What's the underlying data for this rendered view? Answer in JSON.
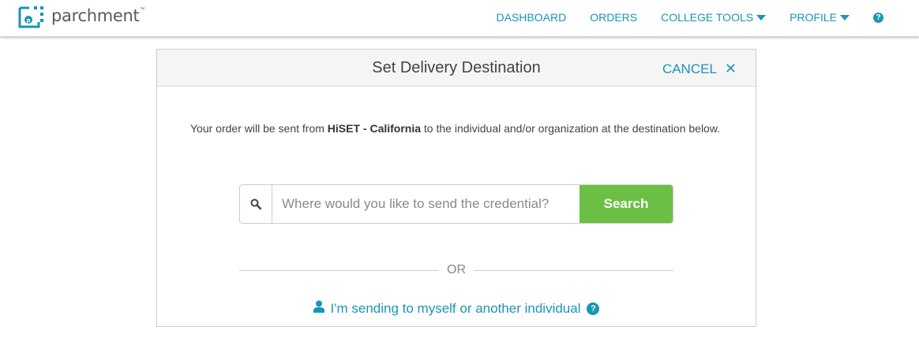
{
  "brand": {
    "name": "parchment",
    "trademark": "™"
  },
  "nav": {
    "dashboard": "DASHBOARD",
    "orders": "ORDERS",
    "college_tools": "COLLEGE TOOLS",
    "profile": "PROFILE",
    "help_glyph": "?"
  },
  "modal": {
    "title": "Set Delivery Destination",
    "cancel_label": "CANCEL",
    "close_glyph": "✕",
    "intro_before": "Your order will be sent from ",
    "intro_org": "HiSET - California",
    "intro_after": " to the individual and/or organization at the destination below.",
    "search": {
      "placeholder": "Where would you like to send the credential?",
      "value": "",
      "button_label": "Search"
    },
    "or_label": "OR",
    "self_link_label": "I'm sending to myself or another individual",
    "help_glyph": "?"
  },
  "colors": {
    "accent": "#1a95b5",
    "search_button": "#6bbf45",
    "header_bg": "#f5f5f5"
  },
  "icons": [
    "parchment-logo-icon",
    "caret-down-icon",
    "help-icon",
    "close-icon",
    "search-icon",
    "user-icon"
  ]
}
